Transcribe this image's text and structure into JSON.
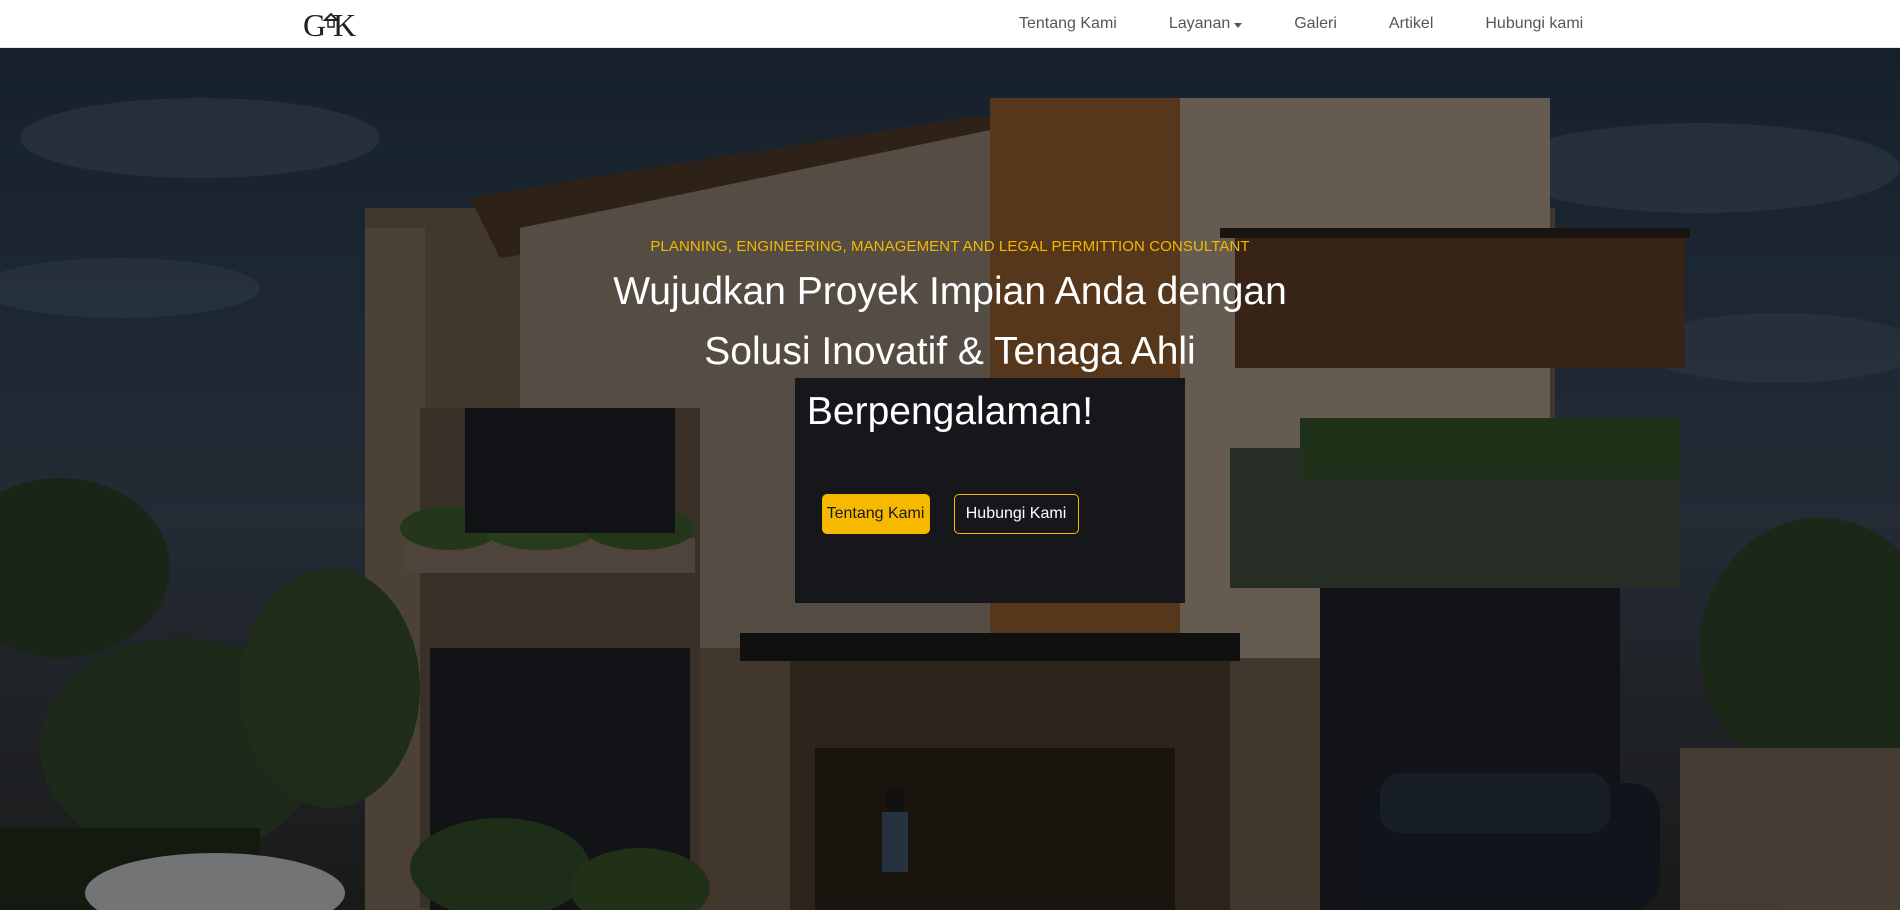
{
  "brand": {
    "logo_text": "GK",
    "logo_icon": "house-roof-icon"
  },
  "nav": {
    "items": [
      {
        "label": "Tentang Kami"
      },
      {
        "label": "Layanan",
        "has_dropdown": true
      },
      {
        "label": "Galeri"
      },
      {
        "label": "Artikel"
      },
      {
        "label": "Hubungi kami"
      }
    ]
  },
  "hero": {
    "tagline": "PLANNING, ENGINEERING, MANAGEMENT AND LEGAL PERMITTION CONSULTANT",
    "headline_lines": [
      "Wujudkan Proyek Impian Anda dengan",
      "Solusi Inovatif & Tenaga Ahli",
      "Berpengalaman!"
    ],
    "primary_button": "Tentang Kami",
    "secondary_button": "Hubungi Kami",
    "background_image": "modern-house-photo"
  },
  "colors": {
    "accent": "#f7b900",
    "nav_text": "#555555",
    "hero_text": "#ffffff"
  }
}
